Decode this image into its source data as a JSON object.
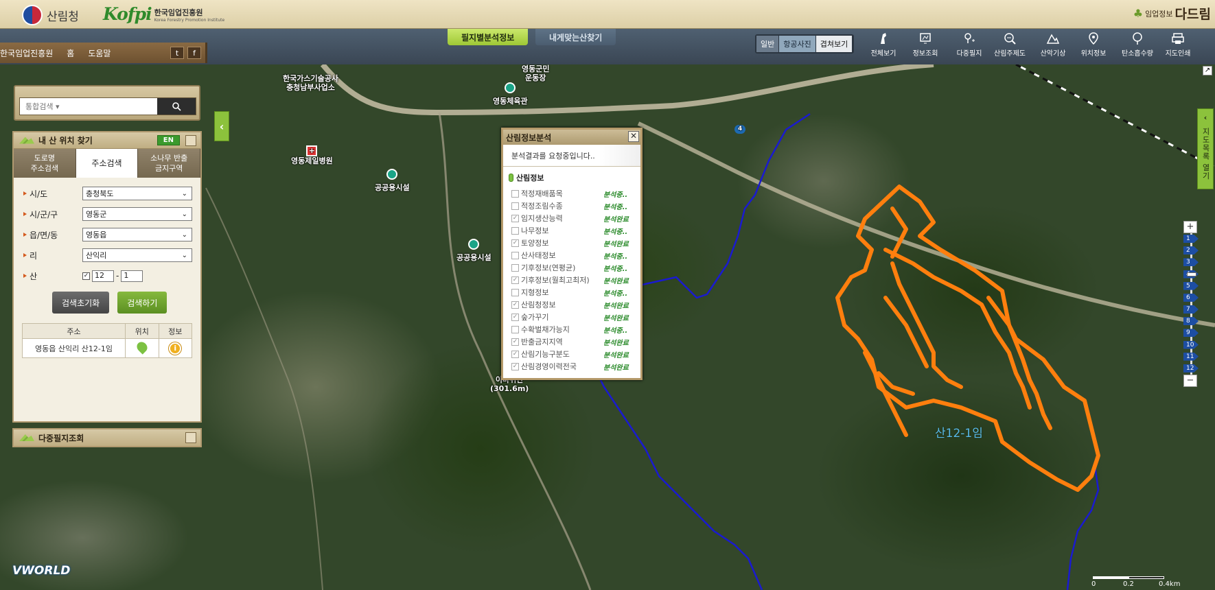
{
  "header": {
    "forest_service": "산림청",
    "kofpi_logo": "Kofpi",
    "kofpi_ko": "한국임업진흥원",
    "kofpi_en": "Korea Forestry Promotion Institute",
    "brand_small": "임업정보",
    "brand_large": "다드림"
  },
  "top_tabs": [
    "필지별분석정보",
    "내게맞는산찾기"
  ],
  "view_modes": [
    "일반",
    "항공사진",
    "겹쳐보기"
  ],
  "tools": [
    {
      "icon": "full-view-icon",
      "label": "전체보기"
    },
    {
      "icon": "info-query-icon",
      "label": "정보조회"
    },
    {
      "icon": "multi-parcel-icon",
      "label": "다중필지"
    },
    {
      "icon": "forest-theme-icon",
      "label": "산림주제도"
    },
    {
      "icon": "mountain-weather-icon",
      "label": "산악기상"
    },
    {
      "icon": "location-icon",
      "label": "위치정보"
    },
    {
      "icon": "carbon-storage-icon",
      "label": "탄소흡수량"
    },
    {
      "icon": "map-print-icon",
      "label": "지도인쇄"
    }
  ],
  "breadcrumb": [
    "한국임업진흥원",
    "홈",
    "도움말"
  ],
  "social": {
    "twitter": "t",
    "facebook": "f"
  },
  "search": {
    "placeholder": "통합검색 ▾"
  },
  "find_panel": {
    "title": "내 산 위치 찾기",
    "en": "EN",
    "tabs": [
      {
        "label": "도로명\n주소검색"
      },
      {
        "label": "주소검색"
      },
      {
        "label": "소나무 반출\n금지구역"
      }
    ],
    "fields": [
      {
        "label": "시/도",
        "value": "충청북도"
      },
      {
        "label": "시/군/구",
        "value": "영동군"
      },
      {
        "label": "읍/면/동",
        "value": "영동읍"
      },
      {
        "label": "리",
        "value": "산익리"
      }
    ],
    "san_label": "산",
    "san_main": "12",
    "san_dash": "-",
    "san_sub": "1",
    "reset_label": "검색초기화",
    "search_label": "검색하기",
    "result_headers": [
      "주소",
      "위치",
      "정보"
    ],
    "result_rows": [
      {
        "address": "영동읍 산익리 산12-1임"
      }
    ]
  },
  "multi_panel": {
    "title": "다중필지조회"
  },
  "map_list_tab": {
    "label": "지도목록 열기"
  },
  "map_labels": {
    "parcel": "산12-1임",
    "poi": [
      {
        "name": "한국가스기술공사\n충청남부사업소"
      },
      {
        "name": "영동군민\n운동장"
      },
      {
        "name": "영동체육관"
      },
      {
        "name": "영동제일병원"
      },
      {
        "name": "공공용시설"
      },
      {
        "name": "공공용시설"
      },
      {
        "name": "이바위산\n(301.6m)"
      }
    ],
    "road_number": "4"
  },
  "zoom_levels": [
    "1",
    "2",
    "3",
    "4",
    "5",
    "6",
    "7",
    "8",
    "9",
    "10",
    "11",
    "12"
  ],
  "zoom_current": 4,
  "dialog": {
    "title": "산림정보분석",
    "status": "분석결과를 요청중입니다..",
    "section": "산림정보",
    "items": [
      {
        "name": "적정재배품목",
        "checked": false,
        "status": "분석중.."
      },
      {
        "name": "적정조림수종",
        "checked": false,
        "status": "분석중.."
      },
      {
        "name": "임지생산능력",
        "checked": true,
        "status": "분석완료"
      },
      {
        "name": "나무정보",
        "checked": false,
        "status": "분석중.."
      },
      {
        "name": "토양정보",
        "checked": true,
        "status": "분석완료"
      },
      {
        "name": "산사태정보",
        "checked": false,
        "status": "분석중.."
      },
      {
        "name": "기후정보(연평균)",
        "checked": false,
        "status": "분석중.."
      },
      {
        "name": "기후정보(월최고최저)",
        "checked": true,
        "status": "분석완료"
      },
      {
        "name": "지형정보",
        "checked": false,
        "status": "분석중.."
      },
      {
        "name": "산림청정보",
        "checked": true,
        "status": "분석완료"
      },
      {
        "name": "숲가꾸기",
        "checked": true,
        "status": "분석완료"
      },
      {
        "name": "수확벌채가능지",
        "checked": false,
        "status": "분석중.."
      },
      {
        "name": "반출금지지역",
        "checked": true,
        "status": "분석완료"
      },
      {
        "name": "산림기능구분도",
        "checked": true,
        "status": "분석완료"
      },
      {
        "name": "산림경영이력전국",
        "checked": true,
        "status": "분석완료"
      }
    ]
  },
  "scale": {
    "labels": [
      "0",
      "0.2",
      "0.4km"
    ]
  },
  "vworld": "VWORLD",
  "colors": {
    "parcel_outline": "#ff7f0e",
    "boundary_line": "#1a1ad0",
    "accent_green": "#9ec835"
  }
}
